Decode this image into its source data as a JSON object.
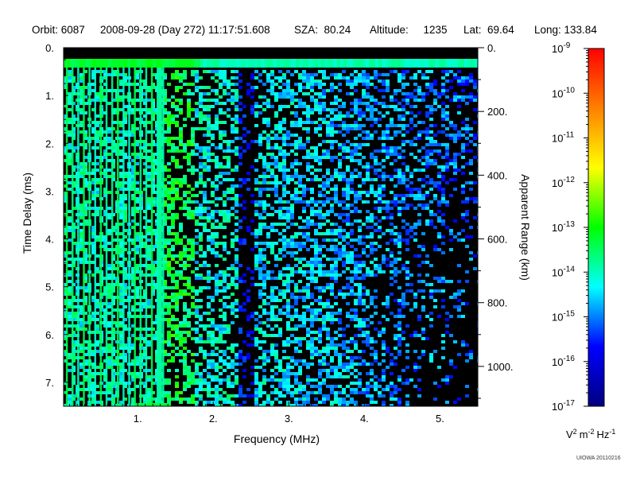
{
  "header": {
    "orbit": "Orbit: 6087",
    "datetime": "2008-09-28 (Day 272) 11:17:51.608",
    "sza": "SZA:  80.24",
    "altitude": "Altitude:     1235",
    "lat": "Lat:  69.64",
    "long": "Long: 133.84"
  },
  "credit": "UIOWA 20110216",
  "chart_data": {
    "type": "heatmap",
    "xlabel": "Frequency (MHz)",
    "ylabel": "Time Delay (ms)",
    "y2label": "Apparent Range (km)",
    "xlim": [
      0.02,
      5.5
    ],
    "ylim": [
      0,
      7.5
    ],
    "x_ticks": [
      {
        "value": 1,
        "label": "1."
      },
      {
        "value": 2,
        "label": "2."
      },
      {
        "value": 3,
        "label": "3."
      },
      {
        "value": 4,
        "label": "4."
      },
      {
        "value": 5,
        "label": "5."
      }
    ],
    "y_ticks": [
      {
        "value": 0,
        "label": "0."
      },
      {
        "value": 1,
        "label": "1."
      },
      {
        "value": 2,
        "label": "2."
      },
      {
        "value": 3,
        "label": "3."
      },
      {
        "value": 4,
        "label": "4."
      },
      {
        "value": 5,
        "label": "5."
      },
      {
        "value": 6,
        "label": "6."
      },
      {
        "value": 7,
        "label": "7."
      }
    ],
    "y2_ticks": [
      {
        "value": 0,
        "label": "0."
      },
      {
        "value": 200,
        "label": "200."
      },
      {
        "value": 400,
        "label": "400."
      },
      {
        "value": 600,
        "label": "600."
      },
      {
        "value": 800,
        "label": "800."
      },
      {
        "value": 1000,
        "label": "1000."
      }
    ],
    "colorbar": {
      "scale": "log",
      "min_exp": -17,
      "max_exp": -9,
      "labels": [
        {
          "exp": -9,
          "base": "10",
          "sup": "-9"
        },
        {
          "exp": -10,
          "base": "10",
          "sup": "-10"
        },
        {
          "exp": -11,
          "base": "10",
          "sup": "-11"
        },
        {
          "exp": -12,
          "base": "10",
          "sup": "-12"
        },
        {
          "exp": -13,
          "base": "10",
          "sup": "-13"
        },
        {
          "exp": -14,
          "base": "10",
          "sup": "-14"
        },
        {
          "exp": -15,
          "base": "10",
          "sup": "-15"
        },
        {
          "exp": -16,
          "base": "10",
          "sup": "-16"
        },
        {
          "exp": -17,
          "base": "10",
          "sup": "-17"
        }
      ],
      "unit": {
        "v": "V",
        "v_sup": "2",
        "m": "m",
        "m_sup": "-2",
        "hz": "Hz",
        "hz_sup": "-1"
      },
      "colors": [
        "#000080",
        "#0000ff",
        "#00ffff",
        "#00ff00",
        "#ffff00",
        "#ff8000",
        "#ff0000"
      ]
    },
    "background_color": "#000000"
  }
}
